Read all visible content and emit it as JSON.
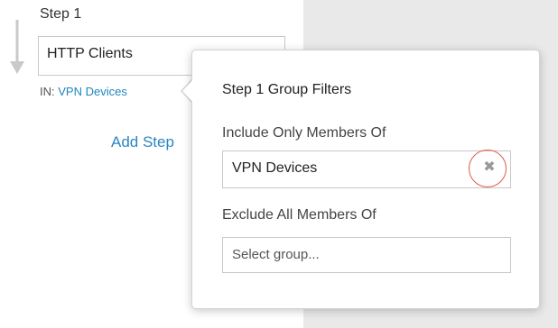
{
  "step": {
    "title": "Step 1",
    "input_value": "HTTP Clients",
    "in_prefix": "IN: ",
    "in_group": "VPN Devices",
    "add_step_label": "Add Step"
  },
  "popover": {
    "title": "Step 1 Group Filters",
    "include": {
      "label": "Include Only Members Of",
      "value": "VPN Devices",
      "clear_icon": "close-icon"
    },
    "exclude": {
      "label": "Exclude All Members Of",
      "placeholder": "Select group..."
    }
  },
  "colors": {
    "link": "#1f86c0",
    "highlight": "#e05a4e",
    "panel_bg": "#e9e9e9"
  }
}
